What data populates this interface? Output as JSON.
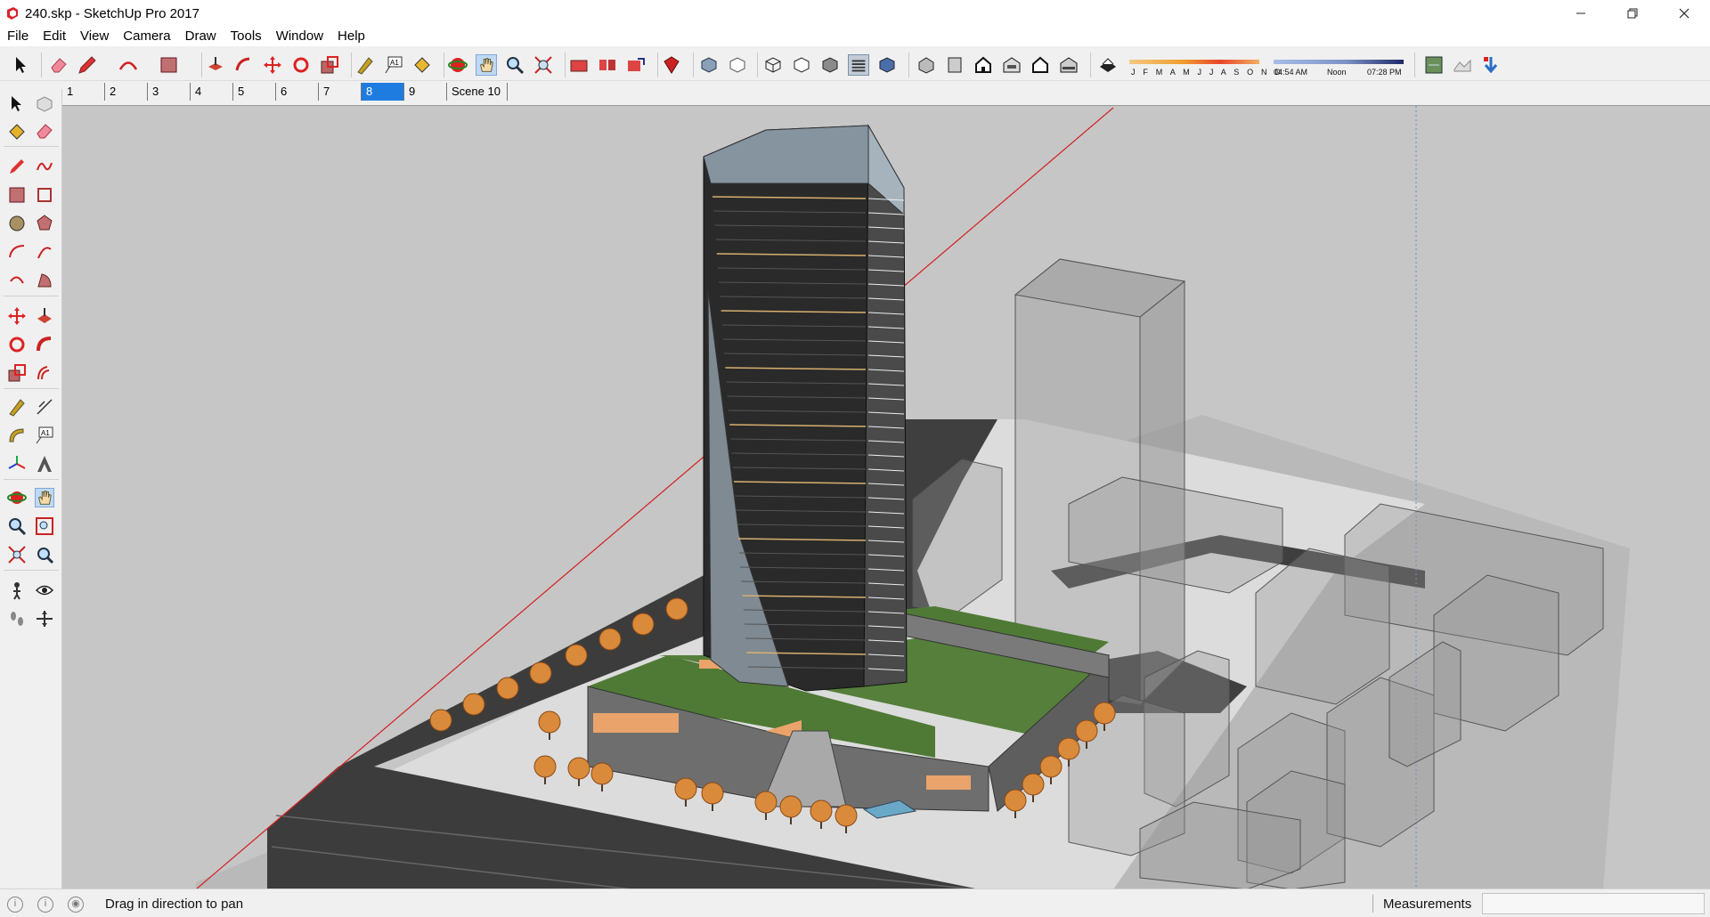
{
  "window": {
    "title": "240.skp - SketchUp Pro 2017",
    "app_icon": "sketchup-logo-icon",
    "controls": [
      "minimize-icon",
      "restore-icon",
      "close-icon"
    ]
  },
  "menubar": {
    "items": [
      "File",
      "Edit",
      "View",
      "Camera",
      "Draw",
      "Tools",
      "Window",
      "Help"
    ]
  },
  "toolbar": {
    "shadow": {
      "months": "J F M A M J J A S O N D",
      "time_start": "04:54 AM",
      "time_noon": "Noon",
      "time_end": "07:28 PM"
    }
  },
  "scenes": {
    "tabs": [
      "1",
      "2",
      "3",
      "4",
      "5",
      "6",
      "7",
      "8",
      "9",
      "Scene 10"
    ],
    "active": "8"
  },
  "statusbar": {
    "hint": "Drag in direction to pan",
    "measurements_label": "Measurements",
    "measurements_value": ""
  },
  "colors": {
    "accent": "#1e7ce0",
    "viewport_bg": "#c6c6c6",
    "road": "#3c3c3c",
    "green_roof": "#4f7a35",
    "tree_foliage": "#d98a3a",
    "axis_red": "#d21f1f"
  }
}
